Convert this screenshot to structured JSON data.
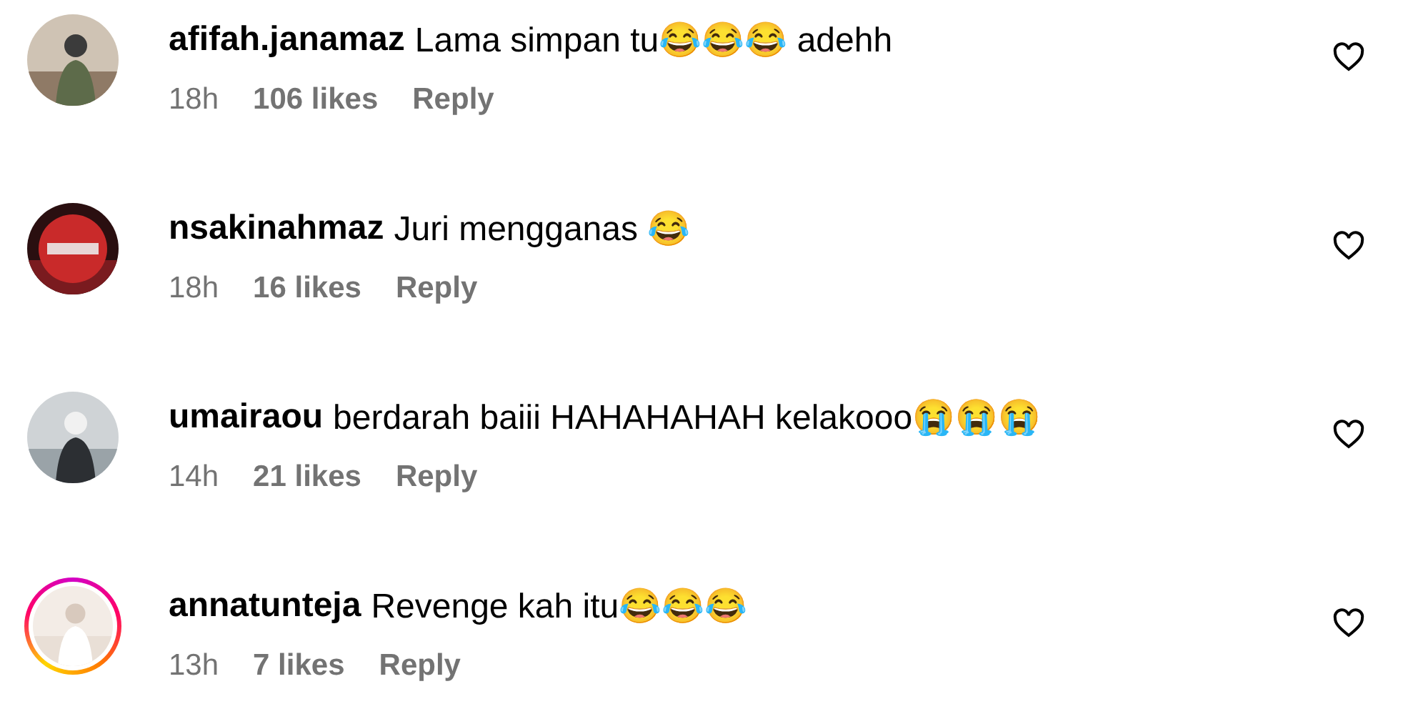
{
  "comments": [
    {
      "avatar": {
        "kind": "picture",
        "story_ring": false
      },
      "username": "afifah.janamaz",
      "text": "Lama simpan tu😂😂😂 adehh",
      "time": "18h",
      "likes": "106 likes",
      "reply": "Reply",
      "liked": false
    },
    {
      "avatar": {
        "kind": "picture",
        "story_ring": false
      },
      "username": "nsakinahmaz",
      "text": "Juri mengganas 😂",
      "time": "18h",
      "likes": "16 likes",
      "reply": "Reply",
      "liked": false
    },
    {
      "avatar": {
        "kind": "picture",
        "story_ring": false
      },
      "username": "umairaou",
      "text": "berdarah baiii HAHAHAHAH kelakooo😭😭😭",
      "time": "14h",
      "likes": "21 likes",
      "reply": "Reply",
      "liked": false
    },
    {
      "avatar": {
        "kind": "picture",
        "story_ring": true
      },
      "username": "annatunteja",
      "text": "Revenge kah itu😂😂😂",
      "time": "13h",
      "likes": "7 likes",
      "reply": "Reply",
      "liked": false
    }
  ]
}
